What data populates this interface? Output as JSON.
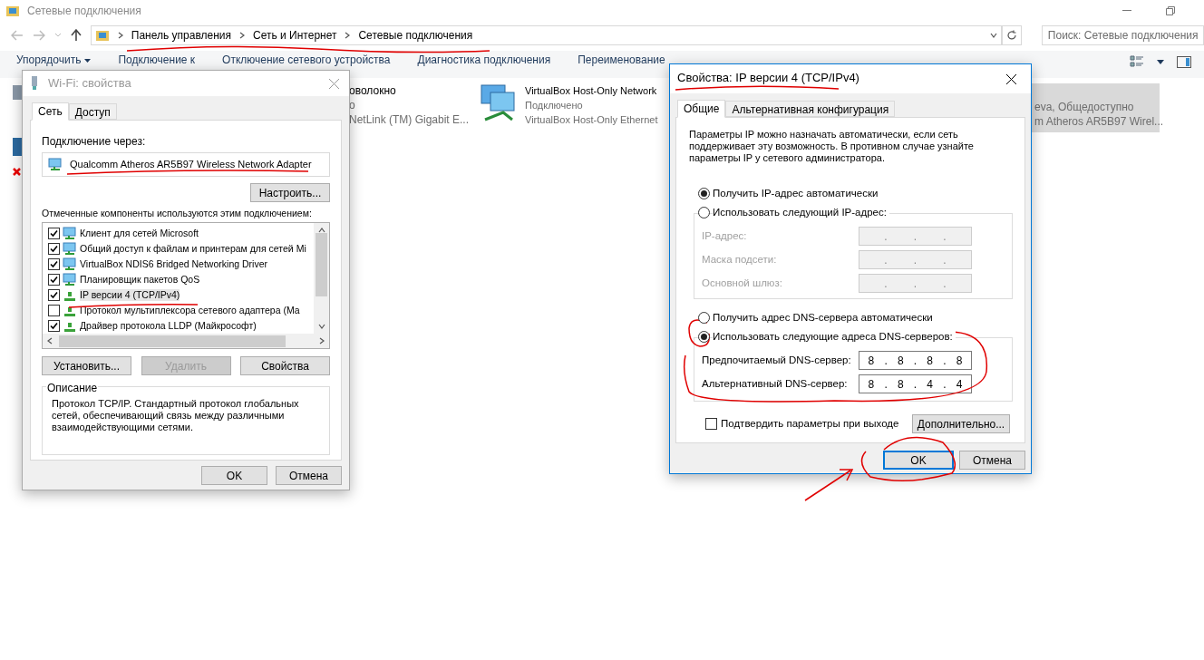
{
  "explorer": {
    "title": "Сетевые подключения",
    "breadcrumb": [
      "Панель управления",
      "Сеть и Интернет",
      "Сетевые подключения"
    ],
    "search": {
      "placeholder": "Поиск: Сетевые подключения"
    },
    "toolbar": [
      {
        "label": "Упорядочить",
        "dropdown": true
      },
      {
        "label": "Подключение к",
        "dropdown": false
      },
      {
        "label": "Отключение сетевого устройства",
        "dropdown": false
      },
      {
        "label": "Диагностика подключения",
        "dropdown": false
      },
      {
        "label": "Переименование",
        "dropdown": false
      }
    ],
    "connections": [
      {
        "selected": false,
        "lines": [
          "оволокно",
          "о",
          "NetLink (TM) Gigabit E..."
        ]
      },
      {
        "selected": false,
        "lines": [
          "VirtualBox Host-Only Network",
          "Подключено",
          "VirtualBox Host-Only Ethernet"
        ]
      },
      {
        "selected": true,
        "lines": [
          "eva, Общедоступно",
          "m Atheros AR5B97 Wirel..."
        ]
      }
    ]
  },
  "wifi_dialog": {
    "title": "Wi-Fi: свойства",
    "active": false,
    "tabs": [
      {
        "label": "Сеть",
        "selected": true
      },
      {
        "label": "Доступ",
        "selected": false
      }
    ],
    "connect_via_label": "Подключение через:",
    "adapter": "Qualcomm Atheros AR5B97 Wireless Network Adapter",
    "configure_button": "Настроить...",
    "components_label": "Отмеченные компоненты используются этим подключением:",
    "components": [
      {
        "label": "Клиент для сетей Microsoft",
        "kind": "client",
        "checked": true,
        "selected": false
      },
      {
        "label": "Общий доступ к файлам и принтерам для сетей Mi",
        "kind": "service",
        "checked": true,
        "selected": false
      },
      {
        "label": "VirtualBox NDIS6 Bridged Networking Driver",
        "kind": "service",
        "checked": true,
        "selected": false
      },
      {
        "label": "Планировщик пакетов QoS",
        "kind": "service",
        "checked": true,
        "selected": false
      },
      {
        "label": "IP версии 4 (TCP/IPv4)",
        "kind": "protocol",
        "checked": true,
        "selected": true
      },
      {
        "label": "Протокол мультиплексора сетевого адаптера (Ма",
        "kind": "protocol",
        "checked": false,
        "selected": false
      },
      {
        "label": "Драйвер протокола LLDP (Майкрософт)",
        "kind": "protocol",
        "checked": true,
        "selected": false
      }
    ],
    "actions": [
      {
        "label": "Установить...",
        "disabled": false
      },
      {
        "label": "Удалить",
        "disabled": true
      },
      {
        "label": "Свойства",
        "disabled": false
      }
    ],
    "description_title": "Описание",
    "description": "Протокол TCP/IP. Стандартный протокол глобальных сетей, обеспечивающий связь между различными взаимодействующими сетями.",
    "buttons": [
      {
        "label": "OK",
        "default": false
      },
      {
        "label": "Отмена",
        "default": false
      }
    ]
  },
  "ipv4_dialog": {
    "title": "Свойства: IP версии 4 (TCP/IPv4)",
    "active": true,
    "tabs": [
      {
        "label": "Общие",
        "selected": true
      },
      {
        "label": "Альтернативная конфигурация",
        "selected": false
      }
    ],
    "intro": "Параметры IP можно назначать автоматически, если сеть поддерживает эту возможность. В противном случае узнайте параметры IP у сетевого администратора.",
    "ip_radios": [
      {
        "label": "Получить IP-адрес автоматически",
        "selected": true
      },
      {
        "label": "Использовать следующий IP-адрес:",
        "selected": false
      }
    ],
    "ip_fields": [
      {
        "label": "IP-адрес:",
        "disabled": true,
        "dots": [
          ".",
          ".",
          "."
        ]
      },
      {
        "label": "Маска подсети:",
        "disabled": true,
        "dots": [
          ".",
          ".",
          "."
        ]
      },
      {
        "label": "Основной шлюз:",
        "disabled": true,
        "dots": [
          ".",
          ".",
          "."
        ]
      }
    ],
    "dns_radios": [
      {
        "label": "Получить адрес DNS-сервера автоматически",
        "selected": false
      },
      {
        "label": "Использовать следующие адреса DNS-серверов:",
        "selected": true
      }
    ],
    "dns_fields": [
      {
        "label": "Предпочитаемый DNS-сервер:",
        "disabled": false,
        "dots": [
          ".",
          ".",
          "."
        ],
        "octets": [
          "8",
          "8",
          "8",
          "8"
        ]
      },
      {
        "label": "Альтернативный DNS-сервер:",
        "disabled": false,
        "dots": [
          ".",
          ".",
          "."
        ],
        "octets": [
          "8",
          "8",
          "4",
          "4"
        ]
      }
    ],
    "confirm": {
      "label": "Подтвердить параметры при выходе",
      "checked": false
    },
    "advanced_button": "Дополнительно...",
    "buttons": [
      {
        "label": "OK",
        "default": true
      },
      {
        "label": "Отмена",
        "default": false
      }
    ]
  }
}
